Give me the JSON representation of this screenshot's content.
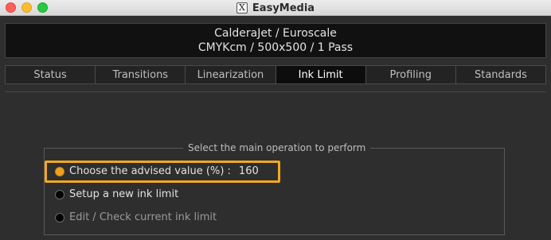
{
  "window": {
    "title": "EasyMedia",
    "app_icon_glyph": "X",
    "app_icon": "x11-app-icon"
  },
  "header": {
    "line1": "CalderaJet / Euroscale",
    "line2": "CMYKcm / 500x500 / 1 Pass"
  },
  "tabs": [
    {
      "label": "Status",
      "active": false
    },
    {
      "label": "Transitions",
      "active": false
    },
    {
      "label": "Linearization",
      "active": false
    },
    {
      "label": "Ink Limit",
      "active": true
    },
    {
      "label": "Profiling",
      "active": false
    },
    {
      "label": "Standards",
      "active": false
    }
  ],
  "operation_group": {
    "legend": "Select the main operation to perform",
    "options": [
      {
        "label": "Choose the advised value (%) :",
        "value": "160",
        "selected": true,
        "enabled": true
      },
      {
        "label": "Setup a new ink limit",
        "selected": false,
        "enabled": true
      },
      {
        "label": "Edit / Check current ink limit",
        "selected": false,
        "enabled": false
      }
    ]
  },
  "colors": {
    "accent_orange": "#f2a81f",
    "background": "#2e2e2e",
    "header_bg": "#111111",
    "active_tab_bg": "#0d0d0d"
  }
}
